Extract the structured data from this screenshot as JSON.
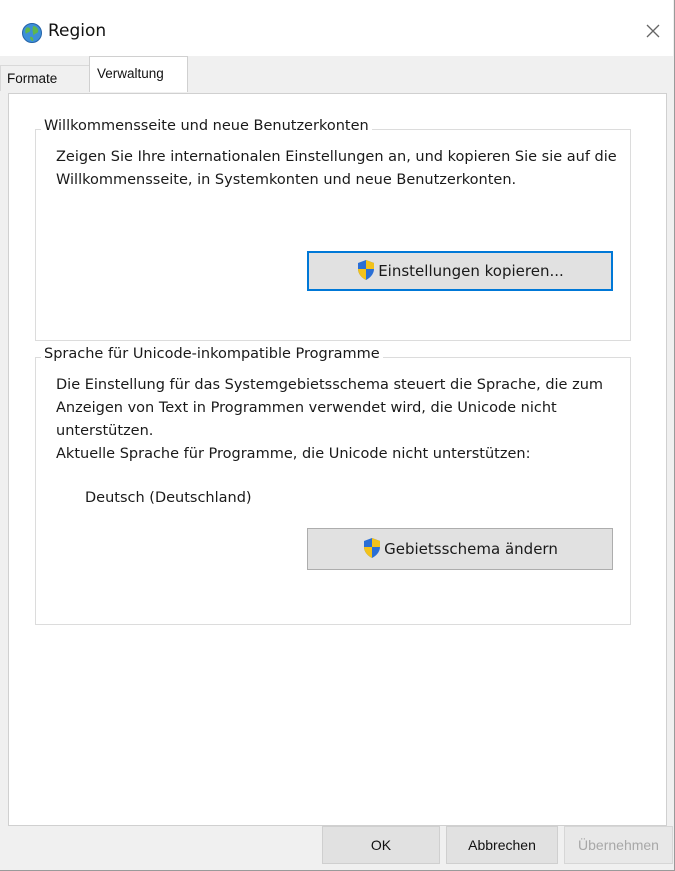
{
  "window": {
    "title": "Region"
  },
  "tabs": [
    {
      "label": "Formate"
    },
    {
      "label": "Verwaltung"
    }
  ],
  "welcome_group": {
    "legend": "Willkommensseite und neue Benutzerkonten",
    "description": "Zeigen Sie Ihre internationalen Einstellungen an, und kopieren Sie sie auf die Willkommensseite, in Systemkonten und neue Benutzerkonten.",
    "copy_button": "Einstellungen kopieren..."
  },
  "unicode_group": {
    "legend": "Sprache für Unicode-inkompatible Programme",
    "description": "Die Einstellung für das Systemgebietsschema steuert die Sprache, die zum Anzeigen von Text in Programmen verwendet wird, die Unicode nicht unterstützen.",
    "current_label": "Aktuelle Sprache für Programme, die Unicode nicht unterstützen:",
    "current_value": "Deutsch (Deutschland)",
    "change_button": "Gebietsschema ändern"
  },
  "footer": {
    "ok": "OK",
    "cancel": "Abbrechen",
    "apply": "Übernehmen"
  },
  "icons": {
    "title": "globe-icon",
    "close": "close-icon",
    "shield": "uac-shield-icon"
  },
  "colors": {
    "focus": "#0078d7",
    "button_bg": "#e1e1e1",
    "shield_blue": "#2a6fd6",
    "shield_yellow": "#f2c21b"
  }
}
